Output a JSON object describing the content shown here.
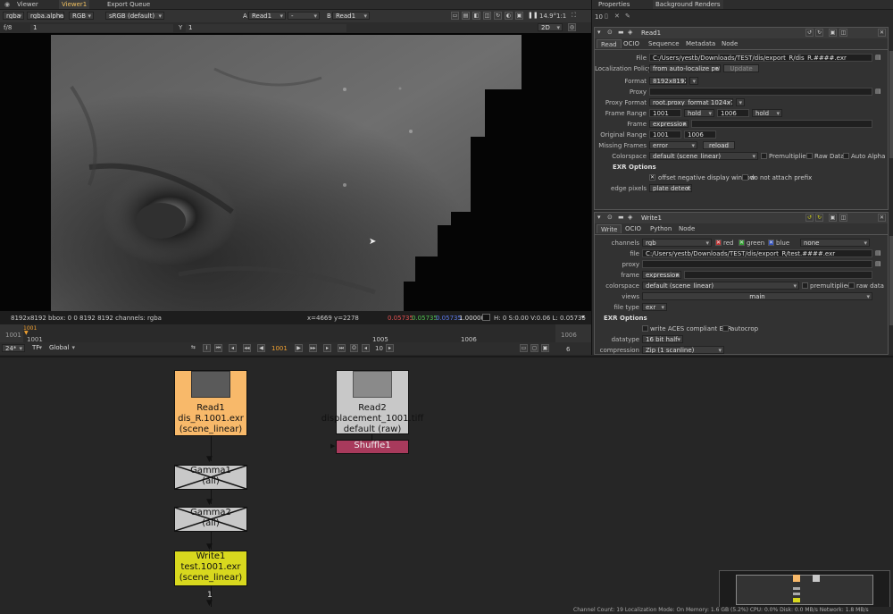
{
  "viewer_tabs": [
    "Viewer",
    "Viewer1",
    "Export Queue"
  ],
  "props_tabs": [
    "Properties",
    "Background Renders"
  ],
  "viewer_toolbar": {
    "layer": "rgba",
    "channel": "rgba.alpha",
    "colorspace_mode": "RGB",
    "display": "sRGB (default)",
    "input_a_label": "A",
    "input_a": "Read1",
    "input_a_op": "-",
    "input_b_label": "B",
    "input_b": "Read1",
    "fstop": "14.9°",
    "zoom": "1:1"
  },
  "viewer_toolbar2": {
    "frame_ratio": "f/8",
    "gain": "1",
    "y_label": "Y",
    "gamma": "1",
    "view_mode": "2D"
  },
  "viewer_info": {
    "format": "8192x8192  bbox: 0 0 8192 8192  channels: rgba",
    "coords": "x=4669 y=2278",
    "r": "0.05735",
    "g": "0.05735",
    "b": "0.05735",
    "a": "1.00000",
    "hsvl": "H:  0 S:0.00 V:0.06  L: 0.05735"
  },
  "timeline": {
    "in_frame": "1001",
    "frame_start": "1001",
    "marker": "1001",
    "tick_1005": "1005",
    "tick_1006": "1006",
    "out_frame": "1006"
  },
  "playback": {
    "fps": "24*",
    "tf": "TF",
    "scope": "Global",
    "current_frame": "1001",
    "step": "10",
    "skip": "0",
    "loop_count": "6"
  },
  "panel_count": "10",
  "read_node": {
    "name": "Read1",
    "tabs": [
      "Read",
      "OCIO",
      "Sequence",
      "Metadata",
      "Node"
    ],
    "file_label": "File",
    "file": "C:/Users/yestb/Downloads/TEST/dis/export_R/dis_R.####.exr",
    "localization_label": "Localization Policy",
    "localization": "from auto-localize path",
    "update_btn": "Update",
    "format_label": "Format",
    "format": "8192x8192",
    "proxy_label": "Proxy",
    "proxy": "",
    "proxy_format_label": "Proxy Format",
    "proxy_format": "root.proxy_format 1024x778",
    "frame_range_label": "Frame Range",
    "frame_first": "1001",
    "frame_before": "hold",
    "frame_last": "1006",
    "frame_after": "hold",
    "frame_label": "Frame",
    "frame_mode": "expression",
    "original_range_label": "Original Range",
    "orig_first": "1001",
    "orig_last": "1006",
    "missing_frames_label": "Missing Frames",
    "missing_frames": "error",
    "reload_btn": "reload",
    "colorspace_label": "Colorspace",
    "colorspace": "default (scene_linear)",
    "premultiplied": "Premultiplied",
    "raw_data": "Raw Data",
    "auto_alpha": "Auto Alpha",
    "exr_options": "EXR Options",
    "offset_negative": "offset negative display window",
    "no_prefix": "do not attach prefix",
    "edge_pixels_label": "edge pixels",
    "edge_pixels": "plate detect"
  },
  "write_node": {
    "name": "Write1",
    "tabs": [
      "Write",
      "OCIO",
      "Python",
      "Node"
    ],
    "channels_label": "channels",
    "channels": "rgb",
    "red": "red",
    "green": "green",
    "blue": "blue",
    "alpha_chan": "none",
    "file_label": "file",
    "file": "C:/Users/yestb/Downloads/TEST/dis/export_R/test.####.exr",
    "proxy_label": "proxy",
    "proxy": "",
    "frame_label": "frame",
    "frame_mode": "expression",
    "colorspace_label": "colorspace",
    "colorspace": "default (scene_linear)",
    "premultiplied": "premultiplied",
    "raw_data": "raw data",
    "views_label": "views",
    "views": "main",
    "file_type_label": "file type",
    "file_type": "exr",
    "exr_options": "EXR Options",
    "write_aces": "write ACES compliant EXR",
    "autocrop": "autocrop",
    "datatype_label": "datatype",
    "datatype": "16 bit half",
    "compression_label": "compression",
    "compression": "Zip (1 scanline)"
  },
  "nodes": {
    "read1": {
      "title": "Read1",
      "line2": "dis_R.1001.exr",
      "line3": "(scene_linear)"
    },
    "read2": {
      "title": "Read2",
      "line2": "displacement_1001.tiff",
      "line3": "default (raw)"
    },
    "shuffle1": {
      "title": "Shuffle1"
    },
    "gamma1": {
      "title": "Gamma1",
      "line2": "(all)"
    },
    "gamma2": {
      "title": "Gamma2",
      "line2": "(all)"
    },
    "write1": {
      "title": "Write1",
      "line2": "test.1001.exr",
      "line3": "(scene_linear)",
      "frame": "1"
    }
  },
  "status_bar": "Channel Count: 19  Localization Mode: On  Memory: 1.6 GB (5.2%)  CPU: 0.0%  Disk: 0.0 MB/s  Network: 1.8 MB/s",
  "colors": {
    "accent": "#f0c060",
    "read_node": "#f8b96a",
    "write_node": "#d8d81e",
    "shuffle_node": "#a83a5c",
    "node_graph_bg": "#262626"
  }
}
